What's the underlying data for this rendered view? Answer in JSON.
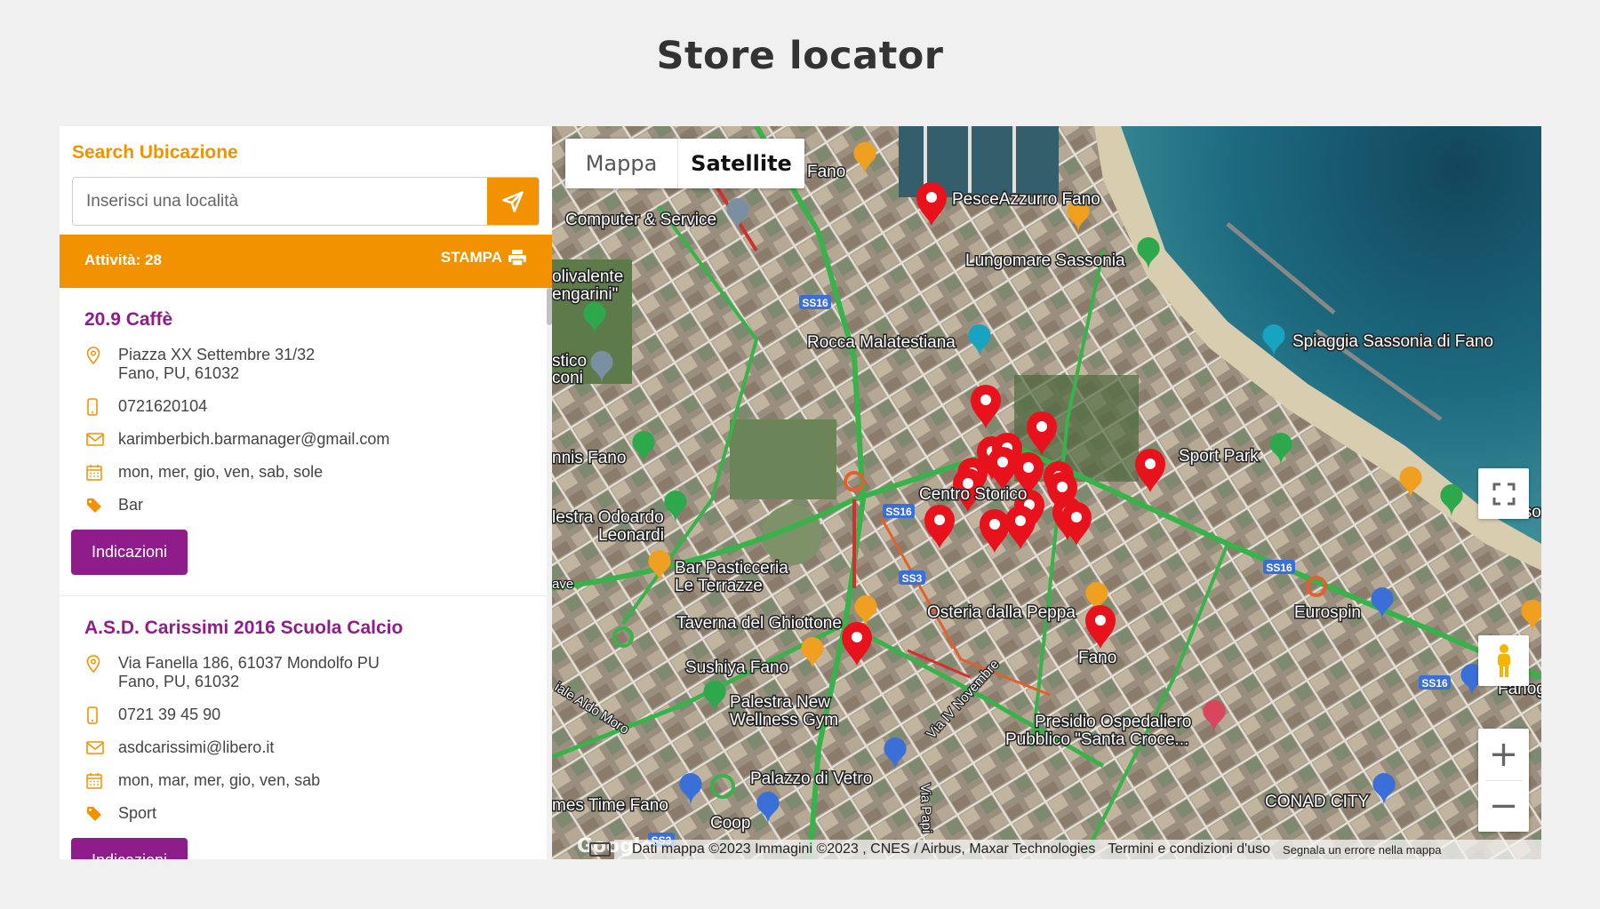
{
  "page": {
    "title": "Store locator"
  },
  "search": {
    "label": "Search Ubicazione",
    "placeholder": "Inserisci una località"
  },
  "results_bar": {
    "count_text": "Attività: 28",
    "print_label": "STAMPA"
  },
  "stores": [
    {
      "name": "20.9 Caffè",
      "address_line1": "Piazza XX Settembre 31/32",
      "address_line2": "Fano, PU, 61032",
      "phone": "0721620104",
      "email": "karimberbich.barmanager@gmail.com",
      "days": "mon, mer, gio, ven, sab, sole",
      "category": "Bar",
      "button_label": "Indicazioni"
    },
    {
      "name": "A.S.D. Carissimi 2016 Scuola Calcio",
      "address_line1": "Via Fanella 186, 61037 Mondolfo PU",
      "address_line2": "Fano, PU, 61032",
      "phone": "0721 39 45 90",
      "email": "asdcarissimi@libero.it",
      "days": "mon, mar, mer, gio, ven, sab",
      "category": "Sport",
      "button_label": "Indicazioni"
    }
  ],
  "map": {
    "type_buttons": {
      "map": "Mappa",
      "satellite": "Satellite"
    },
    "zoom_in": "+",
    "zoom_out": "−",
    "logo": "Google",
    "attribution": "Dati mappa ©2023 Immagini ©2023 , CNES / Airbus, Maxar Technologies",
    "terms": "Termini e condizioni d'uso",
    "report": "Segnala un errore nella mappa",
    "labels": [
      "Fano",
      "PesceAzzurro Fano",
      "Computer & Service",
      "Lungomare Sassonia",
      "Rocca Malatestiana",
      "Spiaggia Sassonia di Fano",
      "Sport Park",
      "Centro Storico",
      "Bar Pasticceria",
      "Le Terrazze",
      "Taverna del Ghiottone",
      "Osteria dalla Peppa",
      "Sushiya Fano",
      "Palestra New",
      "Wellness Gym",
      "Presidio Ospedaliero",
      "Pubblico \"Santa Croce...",
      "Palazzo di Vetro",
      "Coop",
      "Eurospin",
      "CONAD CITY",
      "Fano",
      "nnis Fano",
      "lestra Odoardo",
      "Leonardi",
      "olivalente",
      "engarini\"",
      "stico",
      "coni",
      "Via Papi",
      "Via IV Novembre",
      "iale Aldo Moro",
      "mes Time Fano",
      "Fanoge",
      "Sassonia",
      "ave"
    ],
    "road_labels": [
      "SS16",
      "SS16",
      "SS16",
      "SS16",
      "SS3",
      "SS3"
    ],
    "accent_colors": {
      "marker": "#e8121c",
      "brand_orange": "#f39200",
      "brand_purple": "#8e1c8a"
    }
  }
}
